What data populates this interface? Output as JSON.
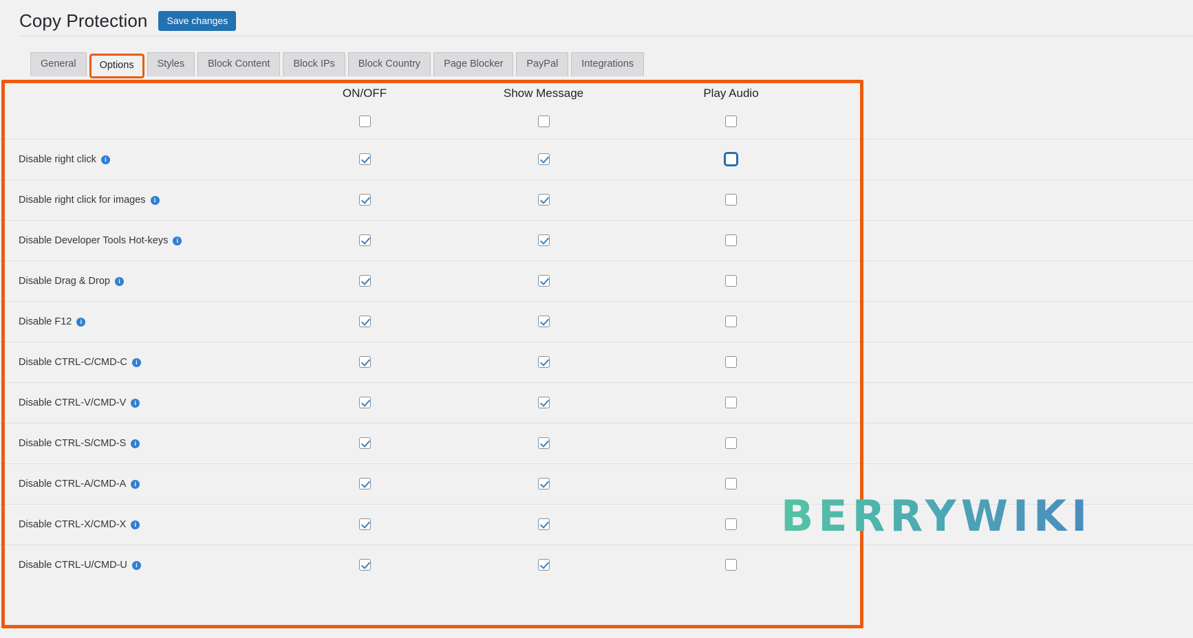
{
  "header": {
    "title": "Copy Protection",
    "save_label": "Save changes"
  },
  "tabs": [
    {
      "label": "General",
      "active": false
    },
    {
      "label": "Options",
      "active": true
    },
    {
      "label": "Styles",
      "active": false
    },
    {
      "label": "Block Content",
      "active": false
    },
    {
      "label": "Block IPs",
      "active": false
    },
    {
      "label": "Block Country",
      "active": false
    },
    {
      "label": "Page Blocker",
      "active": false
    },
    {
      "label": "PayPal",
      "active": false
    },
    {
      "label": "Integrations",
      "active": false
    }
  ],
  "table": {
    "columns": {
      "label": "",
      "onoff": "ON/OFF",
      "show_message": "Show Message",
      "play_audio": "Play Audio"
    },
    "master_row": {
      "label": "",
      "onoff": false,
      "show_message": false,
      "play_audio": false
    },
    "rows": [
      {
        "label": "Disable right click",
        "info": "i",
        "onoff": true,
        "show_message": true,
        "play_audio": false,
        "play_audio_focused": true
      },
      {
        "label": "Disable right click for images",
        "info": "i",
        "onoff": true,
        "show_message": true,
        "play_audio": false,
        "play_audio_focused": false
      },
      {
        "label": "Disable Developer Tools Hot-keys",
        "info": "i",
        "onoff": true,
        "show_message": true,
        "play_audio": false,
        "play_audio_focused": false
      },
      {
        "label": "Disable Drag & Drop",
        "info": "i",
        "onoff": true,
        "show_message": true,
        "play_audio": false,
        "play_audio_focused": false
      },
      {
        "label": "Disable F12",
        "info": "i",
        "onoff": true,
        "show_message": true,
        "play_audio": false,
        "play_audio_focused": false
      },
      {
        "label": "Disable CTRL-C/CMD-C",
        "info": "i",
        "onoff": true,
        "show_message": true,
        "play_audio": false,
        "play_audio_focused": false
      },
      {
        "label": "Disable CTRL-V/CMD-V",
        "info": "i",
        "onoff": true,
        "show_message": true,
        "play_audio": false,
        "play_audio_focused": false
      },
      {
        "label": "Disable CTRL-S/CMD-S",
        "info": "i",
        "onoff": true,
        "show_message": true,
        "play_audio": false,
        "play_audio_focused": false
      },
      {
        "label": "Disable CTRL-A/CMD-A",
        "info": "i",
        "onoff": true,
        "show_message": true,
        "play_audio": false,
        "play_audio_focused": false
      },
      {
        "label": "Disable CTRL-X/CMD-X",
        "info": "i",
        "onoff": true,
        "show_message": true,
        "play_audio": false,
        "play_audio_focused": false
      },
      {
        "label": "Disable CTRL-U/CMD-U",
        "info": "i",
        "onoff": true,
        "show_message": true,
        "play_audio": false,
        "play_audio_focused": false
      }
    ]
  },
  "watermark": {
    "text": "BERRYWIKI"
  },
  "colors": {
    "highlight": "#ec5b11",
    "primary_button": "#2271b1",
    "checkbox_check": "#3582c4",
    "info_icon": "#2f80d1",
    "page_background": "#f1f1f1",
    "watermark_start": "#55c3a4",
    "watermark_end": "#4a8cbe"
  }
}
